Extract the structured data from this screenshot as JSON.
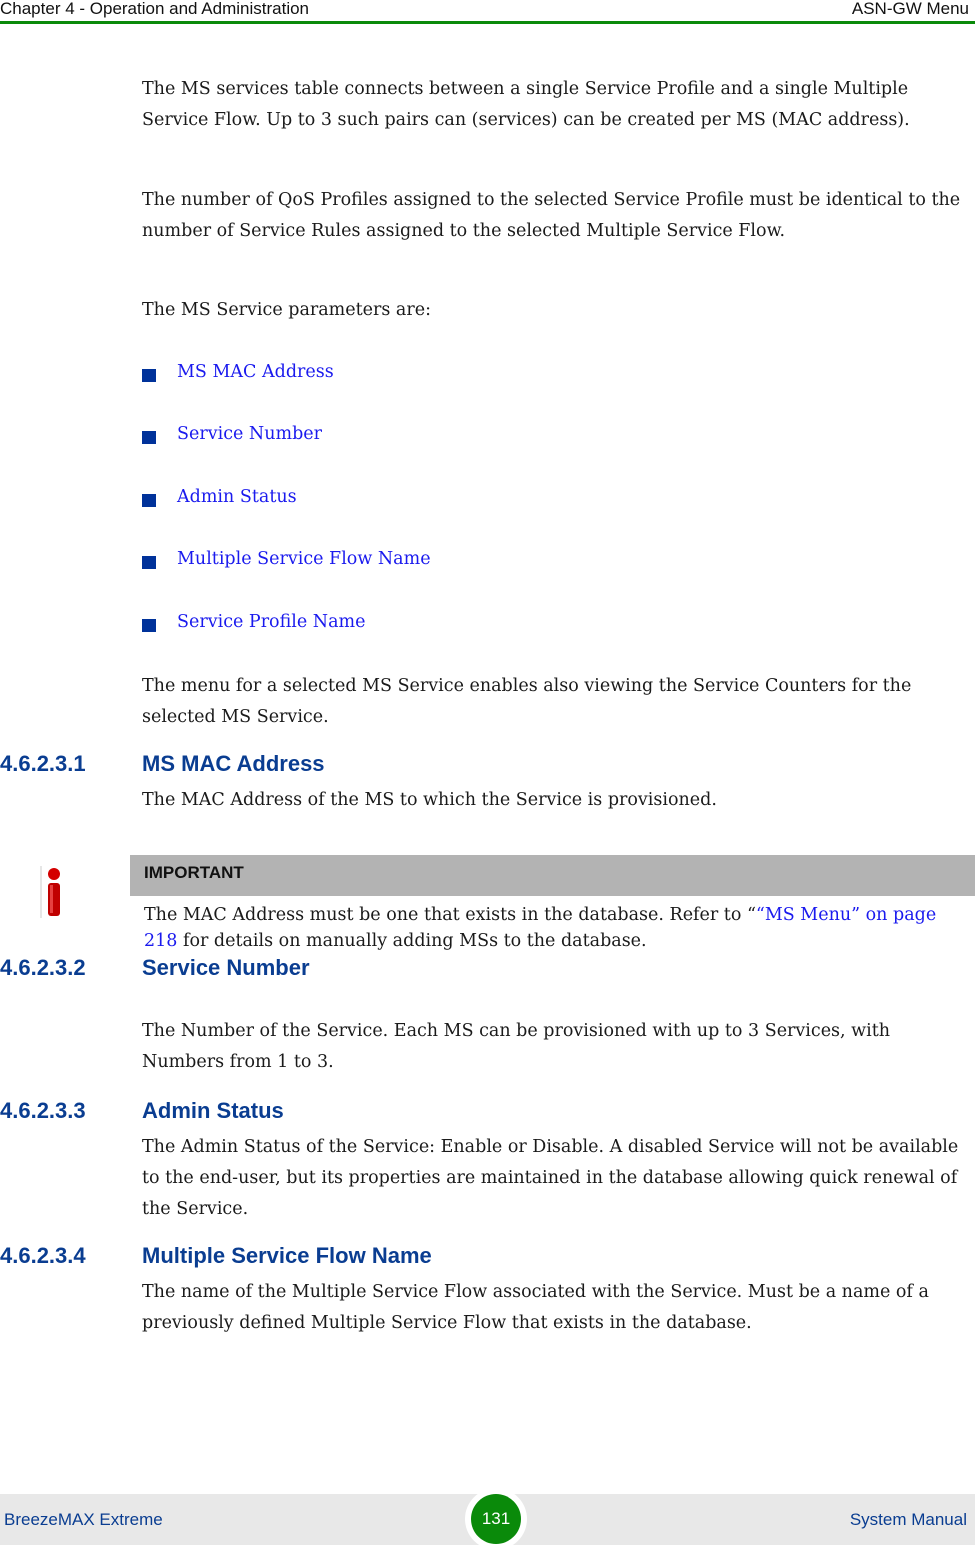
{
  "header": {
    "chapter": "Chapter 4 - Operation and Administration",
    "section": "ASN-GW Menu"
  },
  "intro": {
    "p1": "The MS services table connects between a single Service Profile and a single Multiple Service Flow. Up to 3 such pairs can (services) can be created per MS (MAC address).",
    "p2": "The number of QoS Profiles assigned to the selected Service Profile must be identical to the number of Service Rules assigned to the selected Multiple Service Flow.",
    "p3": "The MS Service parameters are:",
    "bullets": [
      "MS MAC Address",
      "Service Number",
      "Admin Status",
      "Multiple Service Flow Name",
      "Service Profile Name"
    ],
    "p4": "The menu for a selected MS Service enables also viewing the Service Counters for the selected MS Service."
  },
  "sections": [
    {
      "number": "4.6.2.3.1",
      "title": "MS MAC Address",
      "body": "The MAC Address of the MS to which the Service is provisioned."
    },
    {
      "number": "4.6.2.3.2",
      "title": "Service Number",
      "body": "The Number of the Service. Each MS can be provisioned with up to 3 Services, with Numbers from 1 to 3."
    },
    {
      "number": "4.6.2.3.3",
      "title": "Admin Status",
      "body": "The Admin Status of the Service: Enable or Disable. A disabled Service will not be available to the end-user, but its properties are maintained in the database allowing quick renewal of the Service."
    },
    {
      "number": "4.6.2.3.4",
      "title": "Multiple Service Flow Name",
      "body": "The name of the Multiple Service Flow associated with the Service. Must be a name of a previously defined Multiple Service Flow that exists in the database."
    }
  ],
  "important": {
    "label": "IMPORTANT",
    "text_before": "The MAC Address must be one that exists in the database. Refer to “",
    "link": "“MS Menu” on page 218",
    "text_after": " for details on manually adding MSs to the database."
  },
  "footer": {
    "product": "BreezeMAX Extreme",
    "page": "131",
    "doc": "System Manual"
  }
}
